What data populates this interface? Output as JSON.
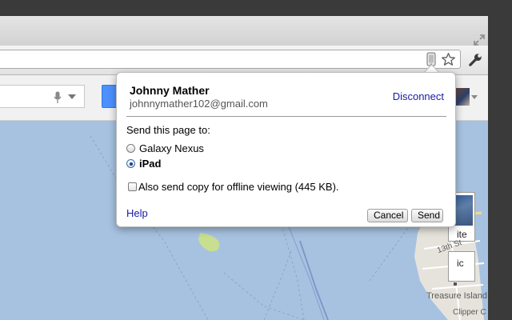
{
  "account": {
    "name": "Johnny Mather",
    "email": "johnnymather102@gmail.com",
    "disconnect_label": "Disconnect"
  },
  "send": {
    "prompt": "Send this page to:",
    "devices": [
      {
        "label": "Galaxy Nexus",
        "selected": false
      },
      {
        "label": "iPad",
        "selected": true
      }
    ],
    "offline_label": "Also send copy for offline viewing (445 KB).",
    "offline_checked": false
  },
  "footer": {
    "help_label": "Help",
    "cancel_label": "Cancel",
    "send_label": "Send"
  },
  "map": {
    "thumb1_label": "ite",
    "thumb2_label": "ic",
    "labels": {
      "street": "13th St",
      "island": "Treasure Island",
      "clipper": "Clipper C"
    }
  },
  "icons": {
    "omnibox_device": "mobile-device-icon",
    "bookmark": "star-icon",
    "menu": "wrench-icon",
    "voice": "microphone-icon",
    "window": "resize-icon"
  },
  "colors": {
    "link": "#1a1aa6",
    "map_water": "#a7c2e1",
    "search_button": "#4d90fe"
  }
}
